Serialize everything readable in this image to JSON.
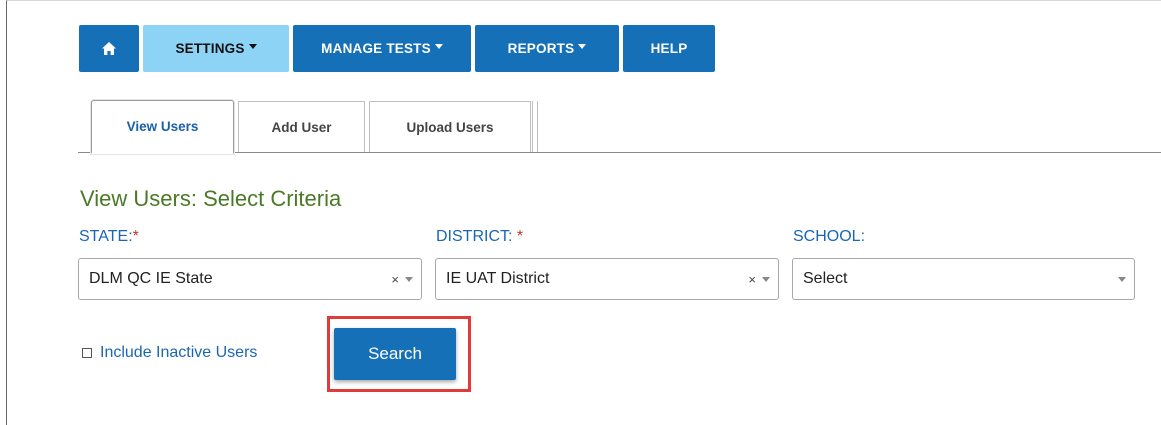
{
  "nav": {
    "home_icon": "home-icon",
    "items": [
      {
        "label": "SETTINGS",
        "dropdown": true,
        "active": true
      },
      {
        "label": "MANAGE TESTS",
        "dropdown": true,
        "active": false
      },
      {
        "label": "REPORTS",
        "dropdown": true,
        "active": false
      },
      {
        "label": "HELP",
        "dropdown": false,
        "active": false
      }
    ]
  },
  "tabs": [
    {
      "label": "View Users",
      "active": true
    },
    {
      "label": "Add User",
      "active": false
    },
    {
      "label": "Upload Users",
      "active": false
    }
  ],
  "main": {
    "title": "View Users: Select Criteria",
    "state": {
      "label": "STATE:",
      "required_mark": "*",
      "value": "DLM QC IE State",
      "clear_symbol": "×"
    },
    "district": {
      "label": "DISTRICT: ",
      "required_mark": "*",
      "value": "IE UAT District",
      "clear_symbol": "×"
    },
    "school": {
      "label": "SCHOOL:",
      "value": "Select"
    },
    "include_inactive": {
      "label": "Include Inactive Users",
      "checked": false
    },
    "search_label": "Search"
  },
  "colors": {
    "nav_bg": "#1570b8",
    "nav_active_bg": "#8dd3f5",
    "title_green": "#4a7a26",
    "label_blue": "#1a66b5",
    "required_red": "#c0392b",
    "highlight_red": "#e03a3a"
  }
}
